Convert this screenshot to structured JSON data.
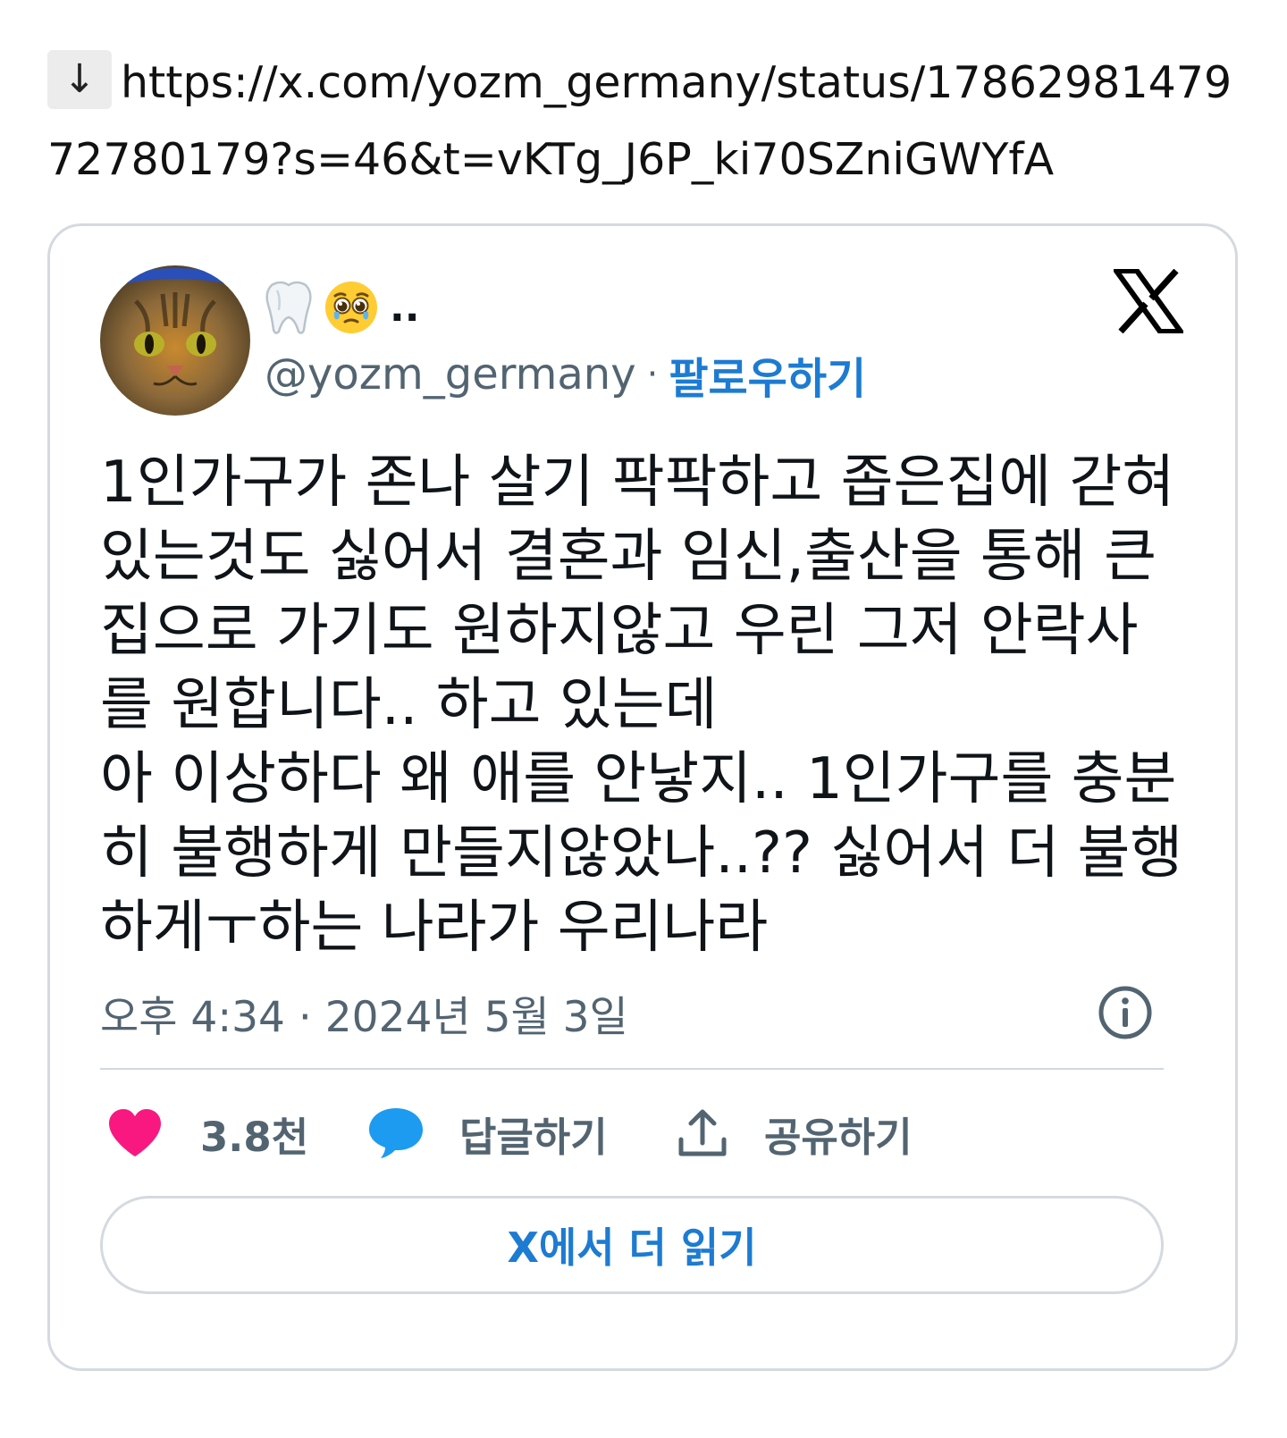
{
  "download_arrow": "↓",
  "link_url": "https://x.com/yozm_germany/status/1786298147972780179?s=46&t=vKTg_J6P_ki70SZniGWYfA",
  "tweet": {
    "display_name_suffix": "..",
    "handle": "@yozm_germany",
    "separator": "·",
    "follow_label": "팔로우하기",
    "text_lines": [
      "1인가구가 존나 살기 팍팍하고 좁은집에 갇혀",
      "있는것도 싫어서 결혼과 임신,출산을 통해 큰",
      "집으로 가기도 원하지않고 우린  그저 안락사",
      "를 원합니다.. 하고 있는데",
      "아 이상하다 왜 애를 안낳지.. 1인가구를 충분",
      "히 불행하게 만들지않았나..?? 싫어서 더 불행",
      "하게ㅜ하는 나라가 우리나라"
    ],
    "timestamp": "오후 4:34 · 2024년 5월 3일",
    "likes_count": "3.8천",
    "reply_label": "답글하기",
    "share_label": "공유하기",
    "read_more_label": "X에서 더 읽기"
  },
  "colors": {
    "link_blue": "#1d7bd1",
    "heart_pink": "#f91880",
    "reply_blue": "#1d9bf0",
    "muted_gray": "#536471",
    "border_gray": "#d4dadf"
  },
  "icons": [
    "download-arrow-icon",
    "tooth-emoji-icon",
    "pleading-face-emoji-icon",
    "x-logo-icon",
    "info-icon",
    "heart-icon",
    "reply-bubble-icon",
    "share-icon"
  ]
}
